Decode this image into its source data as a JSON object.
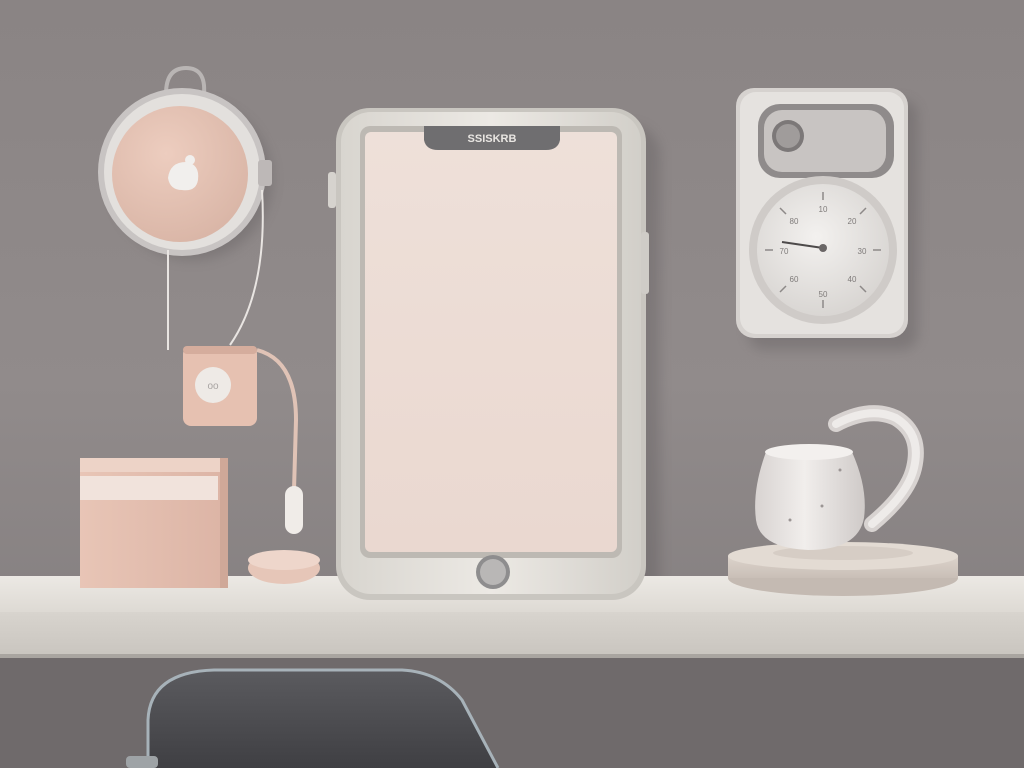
{
  "scene": {
    "description_label": "",
    "tablet": {
      "brand_text": "SSISKRB"
    },
    "gauge": {
      "dial_marks": [
        "10",
        "20",
        "30",
        "40",
        "50",
        "60",
        "70",
        "80"
      ]
    }
  },
  "colors": {
    "wall": "#8d8788",
    "shelf": "#e6e2dc",
    "blush": "#e9c9bb",
    "tablet_body": "#e5e2dc",
    "tablet_screen": "#eddcd5",
    "ceramic": "#e8e4e2",
    "dark_chair": "#4e4e51"
  }
}
